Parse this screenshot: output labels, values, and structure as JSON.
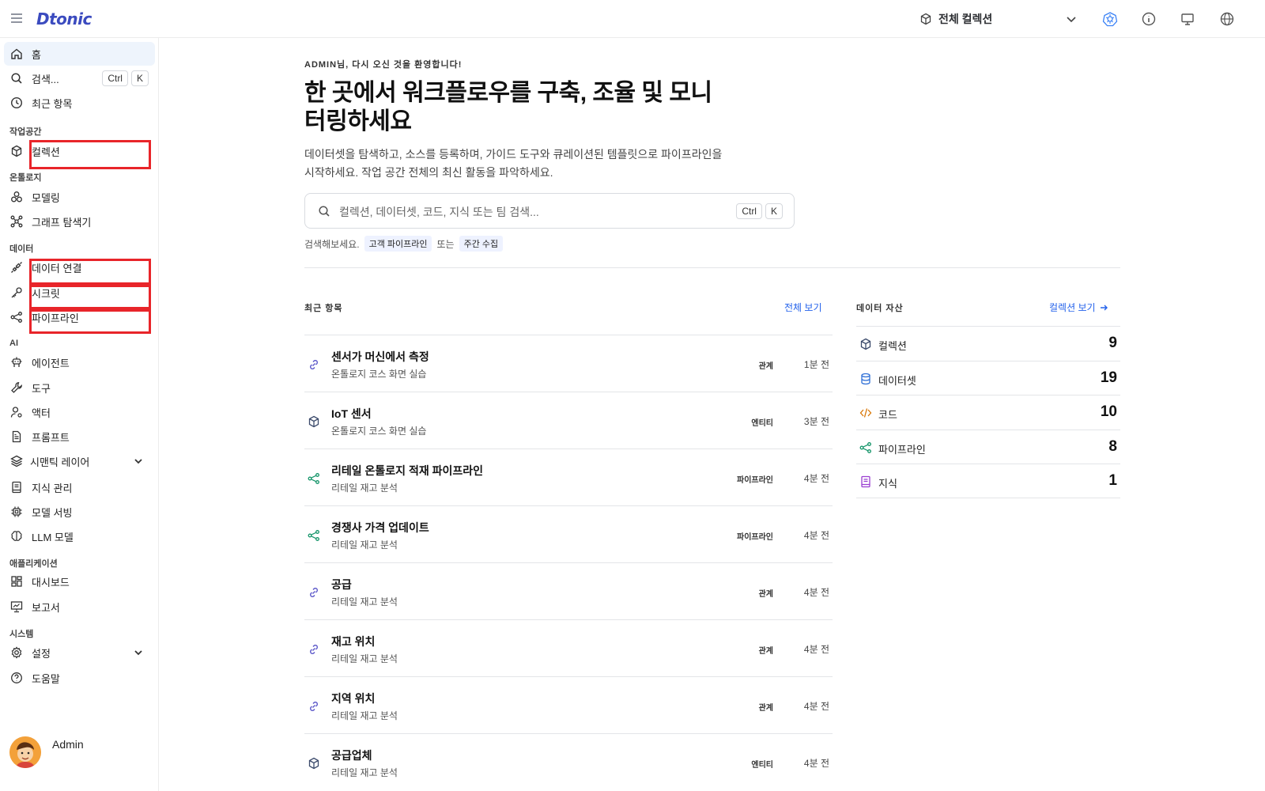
{
  "app": {
    "logo": "Dtonic"
  },
  "topbar": {
    "collection_label": "전체 컬렉션"
  },
  "sidebar": {
    "home": "홈",
    "search": "검색...",
    "search_kbd": [
      "Ctrl",
      "K"
    ],
    "recent": "최근 항목",
    "sections": {
      "workspace": "작업공간",
      "ontology": "온톨로지",
      "data": "데이터",
      "ai": "AI",
      "apps": "애플리케이션",
      "system": "시스템"
    },
    "items": {
      "collection": "컬렉션",
      "modeling": "모델링",
      "graph_explorer": "그래프 탐색기",
      "data_connection": "데이터 연결",
      "secret": "시크릿",
      "pipeline": "파이프라인",
      "agent": "에이전트",
      "tool": "도구",
      "actor": "액터",
      "prompt": "프롬프트",
      "semantic_layer": "시맨틱 레이어",
      "knowledge": "지식 관리",
      "model_serving": "모델 서빙",
      "llm_model": "LLM 모델",
      "dashboard": "대시보드",
      "report": "보고서",
      "settings": "설정",
      "help": "도움말"
    },
    "user_name": "Admin"
  },
  "main": {
    "welcome": "ADMIN님, 다시 오신 것을 환영합니다!",
    "headline": "한 곳에서 워크플로우를 구축, 조율 및 모니터링하세요",
    "subtext": "데이터셋을 탐색하고, 소스를 등록하며, 가이드 도구와 큐레이션된 템플릿으로 파이프라인을 시작하세요. 작업 공간 전체의 최신 활동을 파악하세요.",
    "search_placeholder": "컬렉션, 데이터셋, 코드, 지식 또는 팀 검색...",
    "search_kbd": [
      "Ctrl",
      "K"
    ],
    "try_prefix": "검색해보세요.",
    "try_chip1": "고객 파이프라인",
    "try_or": "또는",
    "try_chip2": "주간 수집"
  },
  "recent": {
    "title": "최근 항목",
    "view_all": "전체 보기",
    "rows": [
      {
        "icon": "link-icon",
        "title": "센서가 머신에서 측정",
        "sub": "온톨로지 코스 화면 실습",
        "type": "관계",
        "time": "1분 전"
      },
      {
        "icon": "cube-icon",
        "title": "IoT 센서",
        "sub": "온톨로지 코스 화면 실습",
        "type": "엔티티",
        "time": "3분 전"
      },
      {
        "icon": "pipeline-icon",
        "title": "리테일 온톨로지 적재 파이프라인",
        "sub": "리테일 재고 분석",
        "type": "파이프라인",
        "time": "4분 전"
      },
      {
        "icon": "pipeline-icon",
        "title": "경쟁사 가격 업데이트",
        "sub": "리테일 재고 분석",
        "type": "파이프라인",
        "time": "4분 전"
      },
      {
        "icon": "link-icon",
        "title": "공급",
        "sub": "리테일 재고 분석",
        "type": "관계",
        "time": "4분 전"
      },
      {
        "icon": "link-icon",
        "title": "재고 위치",
        "sub": "리테일 재고 분석",
        "type": "관계",
        "time": "4분 전"
      },
      {
        "icon": "link-icon",
        "title": "지역 위치",
        "sub": "리테일 재고 분석",
        "type": "관계",
        "time": "4분 전"
      },
      {
        "icon": "cube-icon",
        "title": "공급업체",
        "sub": "리테일 재고 분석",
        "type": "엔티티",
        "time": "4분 전"
      }
    ]
  },
  "assets": {
    "title": "데이터 자산",
    "link": "컬렉션 보기",
    "items": [
      {
        "icon": "cube-icon",
        "name": "컬렉션",
        "count": "9",
        "color": "#3b4a6b"
      },
      {
        "icon": "database-icon",
        "name": "데이터셋",
        "count": "19",
        "color": "#2f6fd6"
      },
      {
        "icon": "code-icon",
        "name": "코드",
        "count": "10",
        "color": "#d97706"
      },
      {
        "icon": "pipeline-icon",
        "name": "파이프라인",
        "count": "8",
        "color": "#17966b"
      },
      {
        "icon": "book-icon",
        "name": "지식",
        "count": "1",
        "color": "#9b3fd1"
      }
    ]
  },
  "colors": {
    "accent": "#2563eb",
    "highlight": "#e8252a",
    "active_bg": "#eef4fc"
  }
}
